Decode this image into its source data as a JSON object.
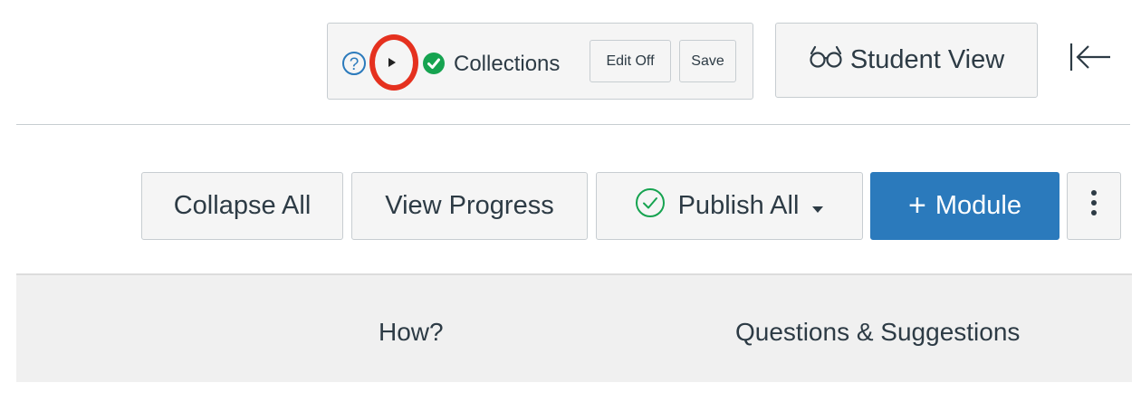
{
  "collections_toolbar": {
    "help_icon": "question-circle-icon",
    "expand_icon": "play-triangle-icon",
    "status_icon": "check-circle-icon",
    "label": "Collections",
    "edit_off_label": "Edit Off",
    "save_label": "Save",
    "highlight_color": "#e5311f",
    "status_color": "#16a350"
  },
  "header": {
    "student_view_icon": "glasses-icon",
    "student_view_label": "Student View",
    "collapse_nav_icon": "collapse-left-arrow-icon"
  },
  "module_actions": {
    "collapse_all_label": "Collapse All",
    "view_progress_label": "View Progress",
    "publish_all_icon": "check-circle-outline-icon",
    "publish_all_label": "Publish All",
    "publish_all_caret": "caret-down-icon",
    "add_module_plus": "+",
    "add_module_label": "Module",
    "more_icon": "kebab-menu-icon",
    "primary_color": "#2b7abc",
    "publish_icon_color": "#16a350"
  },
  "footer": {
    "links": [
      "How?",
      "Questions & Suggestions"
    ]
  }
}
